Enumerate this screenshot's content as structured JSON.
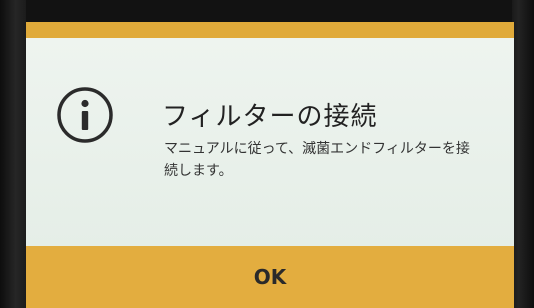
{
  "dialog": {
    "icon": "info-icon",
    "title": "フィルターの接続",
    "message": "マニュアルに従って、滅菌エンドフィルターを接続します。",
    "ok_label": "OK"
  },
  "colors": {
    "accent": "#e3ad3f",
    "background": "#e6efe8",
    "text": "#222222"
  }
}
